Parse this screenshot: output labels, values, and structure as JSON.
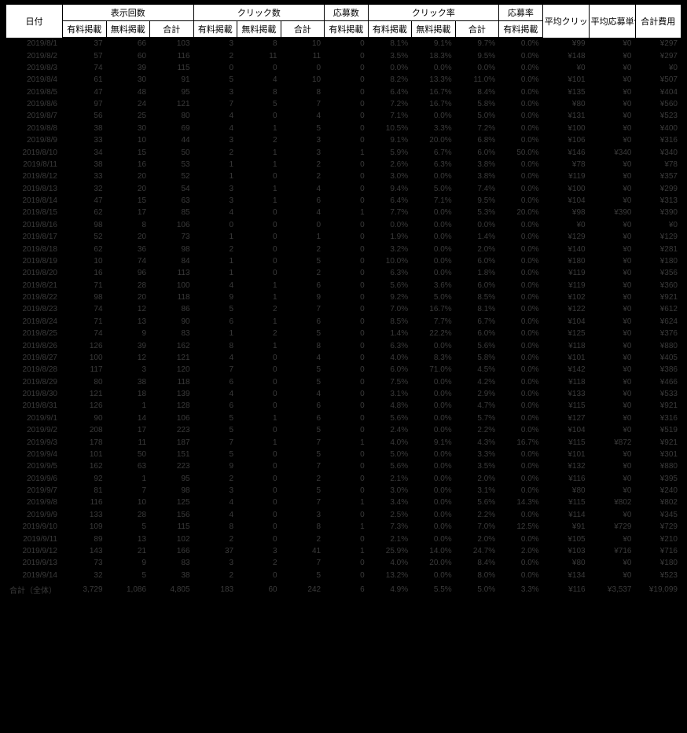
{
  "header": {
    "date": "日付",
    "impressions": "表示回数",
    "clicks": "クリック数",
    "applies": "応募数",
    "ctr": "クリック率",
    "apply_rate": "応募率",
    "avg_cpc": "平均クリック単価",
    "avg_apply_cost": "平均応募単価",
    "total_cost": "合計費用",
    "paid": "有料掲載",
    "free": "無料掲載",
    "total": "合計"
  },
  "summary_label": "合計（全体）",
  "summary": {
    "date": "合計（全体）",
    "imp_paid": "3,729",
    "imp_free": "1,086",
    "imp_total": "4,805",
    "clk_paid": "183",
    "clk_free": "60",
    "clk_total": "242",
    "app_paid": "6",
    "ctr_paid": "4.9%",
    "ctr_free": "5.5%",
    "ctr_total": "5.0%",
    "ar_paid": "3.3%",
    "avg_cpc": "¥116",
    "avg_apply": "¥3,537",
    "cost": "¥19,099"
  },
  "rows": [
    {
      "date": "2019/8/1",
      "imp_paid": "37",
      "imp_free": "66",
      "imp_total": "103",
      "clk_paid": "3",
      "clk_free": "8",
      "clk_total": "10",
      "app_paid": "0",
      "ctr_paid": "8.1%",
      "ctr_free": "9.1%",
      "ctr_total": "9.7%",
      "ar_paid": "0.0%",
      "avg_cpc": "¥99",
      "avg_apply": "¥0",
      "cost": "¥297"
    },
    {
      "date": "2019/8/2",
      "imp_paid": "57",
      "imp_free": "60",
      "imp_total": "116",
      "clk_paid": "2",
      "clk_free": "11",
      "clk_total": "11",
      "app_paid": "0",
      "ctr_paid": "3.5%",
      "ctr_free": "18.3%",
      "ctr_total": "9.5%",
      "ar_paid": "0.0%",
      "avg_cpc": "¥148",
      "avg_apply": "¥0",
      "cost": "¥297"
    },
    {
      "date": "2019/8/3",
      "imp_paid": "74",
      "imp_free": "39",
      "imp_total": "115",
      "clk_paid": "0",
      "clk_free": "0",
      "clk_total": "0",
      "app_paid": "0",
      "ctr_paid": "0.0%",
      "ctr_free": "0.0%",
      "ctr_total": "0.0%",
      "ar_paid": "0.0%",
      "avg_cpc": "¥0",
      "avg_apply": "¥0",
      "cost": "¥0"
    },
    {
      "date": "2019/8/4",
      "imp_paid": "61",
      "imp_free": "30",
      "imp_total": "91",
      "clk_paid": "5",
      "clk_free": "4",
      "clk_total": "10",
      "app_paid": "0",
      "ctr_paid": "8.2%",
      "ctr_free": "13.3%",
      "ctr_total": "11.0%",
      "ar_paid": "0.0%",
      "avg_cpc": "¥101",
      "avg_apply": "¥0",
      "cost": "¥507"
    },
    {
      "date": "2019/8/5",
      "imp_paid": "47",
      "imp_free": "48",
      "imp_total": "95",
      "clk_paid": "3",
      "clk_free": "8",
      "clk_total": "8",
      "app_paid": "0",
      "ctr_paid": "6.4%",
      "ctr_free": "16.7%",
      "ctr_total": "8.4%",
      "ar_paid": "0.0%",
      "avg_cpc": "¥135",
      "avg_apply": "¥0",
      "cost": "¥404"
    },
    {
      "date": "2019/8/6",
      "imp_paid": "97",
      "imp_free": "24",
      "imp_total": "121",
      "clk_paid": "7",
      "clk_free": "5",
      "clk_total": "7",
      "app_paid": "0",
      "ctr_paid": "7.2%",
      "ctr_free": "16.7%",
      "ctr_total": "5.8%",
      "ar_paid": "0.0%",
      "avg_cpc": "¥80",
      "avg_apply": "¥0",
      "cost": "¥560"
    },
    {
      "date": "2019/8/7",
      "imp_paid": "56",
      "imp_free": "25",
      "imp_total": "80",
      "clk_paid": "4",
      "clk_free": "0",
      "clk_total": "4",
      "app_paid": "0",
      "ctr_paid": "7.1%",
      "ctr_free": "0.0%",
      "ctr_total": "5.0%",
      "ar_paid": "0.0%",
      "avg_cpc": "¥131",
      "avg_apply": "¥0",
      "cost": "¥523"
    },
    {
      "date": "2019/8/8",
      "imp_paid": "38",
      "imp_free": "30",
      "imp_total": "69",
      "clk_paid": "4",
      "clk_free": "1",
      "clk_total": "5",
      "app_paid": "0",
      "ctr_paid": "10.5%",
      "ctr_free": "3.3%",
      "ctr_total": "7.2%",
      "ar_paid": "0.0%",
      "avg_cpc": "¥100",
      "avg_apply": "¥0",
      "cost": "¥400"
    },
    {
      "date": "2019/8/9",
      "imp_paid": "33",
      "imp_free": "10",
      "imp_total": "44",
      "clk_paid": "3",
      "clk_free": "2",
      "clk_total": "3",
      "app_paid": "0",
      "ctr_paid": "9.1%",
      "ctr_free": "20.0%",
      "ctr_total": "6.8%",
      "ar_paid": "0.0%",
      "avg_cpc": "¥106",
      "avg_apply": "¥0",
      "cost": "¥316"
    },
    {
      "date": "2019/8/10",
      "imp_paid": "34",
      "imp_free": "15",
      "imp_total": "50",
      "clk_paid": "2",
      "clk_free": "1",
      "clk_total": "3",
      "app_paid": "1",
      "ctr_paid": "5.9%",
      "ctr_free": "6.7%",
      "ctr_total": "6.0%",
      "ar_paid": "50.0%",
      "avg_cpc": "¥146",
      "avg_apply": "¥340",
      "cost": "¥340"
    },
    {
      "date": "2019/8/11",
      "imp_paid": "38",
      "imp_free": "16",
      "imp_total": "53",
      "clk_paid": "1",
      "clk_free": "1",
      "clk_total": "2",
      "app_paid": "0",
      "ctr_paid": "2.6%",
      "ctr_free": "6.3%",
      "ctr_total": "3.8%",
      "ar_paid": "0.0%",
      "avg_cpc": "¥78",
      "avg_apply": "¥0",
      "cost": "¥78"
    },
    {
      "date": "2019/8/12",
      "imp_paid": "33",
      "imp_free": "20",
      "imp_total": "52",
      "clk_paid": "1",
      "clk_free": "0",
      "clk_total": "2",
      "app_paid": "0",
      "ctr_paid": "3.0%",
      "ctr_free": "0.0%",
      "ctr_total": "3.8%",
      "ar_paid": "0.0%",
      "avg_cpc": "¥119",
      "avg_apply": "¥0",
      "cost": "¥357"
    },
    {
      "date": "2019/8/13",
      "imp_paid": "32",
      "imp_free": "20",
      "imp_total": "54",
      "clk_paid": "3",
      "clk_free": "1",
      "clk_total": "4",
      "app_paid": "0",
      "ctr_paid": "9.4%",
      "ctr_free": "5.0%",
      "ctr_total": "7.4%",
      "ar_paid": "0.0%",
      "avg_cpc": "¥100",
      "avg_apply": "¥0",
      "cost": "¥299"
    },
    {
      "date": "2019/8/14",
      "imp_paid": "47",
      "imp_free": "15",
      "imp_total": "63",
      "clk_paid": "3",
      "clk_free": "1",
      "clk_total": "6",
      "app_paid": "0",
      "ctr_paid": "6.4%",
      "ctr_free": "7.1%",
      "ctr_total": "9.5%",
      "ar_paid": "0.0%",
      "avg_cpc": "¥104",
      "avg_apply": "¥0",
      "cost": "¥313"
    },
    {
      "date": "2019/8/15",
      "imp_paid": "62",
      "imp_free": "17",
      "imp_total": "85",
      "clk_paid": "4",
      "clk_free": "0",
      "clk_total": "4",
      "app_paid": "1",
      "ctr_paid": "7.7%",
      "ctr_free": "0.0%",
      "ctr_total": "5.3%",
      "ar_paid": "20.0%",
      "avg_cpc": "¥98",
      "avg_apply": "¥390",
      "cost": "¥390"
    },
    {
      "date": "2019/8/16",
      "imp_paid": "98",
      "imp_free": "8",
      "imp_total": "106",
      "clk_paid": "0",
      "clk_free": "0",
      "clk_total": "0",
      "app_paid": "0",
      "ctr_paid": "0.0%",
      "ctr_free": "0.0%",
      "ctr_total": "0.0%",
      "ar_paid": "0.0%",
      "avg_cpc": "¥0",
      "avg_apply": "¥0",
      "cost": "¥0"
    },
    {
      "date": "2019/8/17",
      "imp_paid": "52",
      "imp_free": "20",
      "imp_total": "73",
      "clk_paid": "1",
      "clk_free": "0",
      "clk_total": "1",
      "app_paid": "0",
      "ctr_paid": "1.9%",
      "ctr_free": "0.0%",
      "ctr_total": "1.4%",
      "ar_paid": "0.0%",
      "avg_cpc": "¥129",
      "avg_apply": "¥0",
      "cost": "¥129"
    },
    {
      "date": "2019/8/18",
      "imp_paid": "62",
      "imp_free": "36",
      "imp_total": "98",
      "clk_paid": "2",
      "clk_free": "0",
      "clk_total": "2",
      "app_paid": "0",
      "ctr_paid": "3.2%",
      "ctr_free": "0.0%",
      "ctr_total": "2.0%",
      "ar_paid": "0.0%",
      "avg_cpc": "¥140",
      "avg_apply": "¥0",
      "cost": "¥281"
    },
    {
      "date": "2019/8/19",
      "imp_paid": "10",
      "imp_free": "74",
      "imp_total": "84",
      "clk_paid": "1",
      "clk_free": "0",
      "clk_total": "5",
      "app_paid": "0",
      "ctr_paid": "10.0%",
      "ctr_free": "0.0%",
      "ctr_total": "6.0%",
      "ar_paid": "0.0%",
      "avg_cpc": "¥180",
      "avg_apply": "¥0",
      "cost": "¥180"
    },
    {
      "date": "2019/8/20",
      "imp_paid": "16",
      "imp_free": "96",
      "imp_total": "113",
      "clk_paid": "1",
      "clk_free": "0",
      "clk_total": "2",
      "app_paid": "0",
      "ctr_paid": "6.3%",
      "ctr_free": "0.0%",
      "ctr_total": "1.8%",
      "ar_paid": "0.0%",
      "avg_cpc": "¥119",
      "avg_apply": "¥0",
      "cost": "¥356"
    },
    {
      "date": "2019/8/21",
      "imp_paid": "71",
      "imp_free": "28",
      "imp_total": "100",
      "clk_paid": "4",
      "clk_free": "1",
      "clk_total": "6",
      "app_paid": "0",
      "ctr_paid": "5.6%",
      "ctr_free": "3.6%",
      "ctr_total": "6.0%",
      "ar_paid": "0.0%",
      "avg_cpc": "¥119",
      "avg_apply": "¥0",
      "cost": "¥360"
    },
    {
      "date": "2019/8/22",
      "imp_paid": "98",
      "imp_free": "20",
      "imp_total": "118",
      "clk_paid": "9",
      "clk_free": "1",
      "clk_total": "9",
      "app_paid": "0",
      "ctr_paid": "9.2%",
      "ctr_free": "5.0%",
      "ctr_total": "8.5%",
      "ar_paid": "0.0%",
      "avg_cpc": "¥102",
      "avg_apply": "¥0",
      "cost": "¥921"
    },
    {
      "date": "2019/8/23",
      "imp_paid": "74",
      "imp_free": "12",
      "imp_total": "86",
      "clk_paid": "5",
      "clk_free": "2",
      "clk_total": "7",
      "app_paid": "0",
      "ctr_paid": "7.0%",
      "ctr_free": "16.7%",
      "ctr_total": "8.1%",
      "ar_paid": "0.0%",
      "avg_cpc": "¥122",
      "avg_apply": "¥0",
      "cost": "¥612"
    },
    {
      "date": "2019/8/24",
      "imp_paid": "71",
      "imp_free": "13",
      "imp_total": "90",
      "clk_paid": "6",
      "clk_free": "1",
      "clk_total": "6",
      "app_paid": "0",
      "ctr_paid": "8.5%",
      "ctr_free": "7.7%",
      "ctr_total": "6.7%",
      "ar_paid": "0.0%",
      "avg_cpc": "¥104",
      "avg_apply": "¥0",
      "cost": "¥624"
    },
    {
      "date": "2019/8/25",
      "imp_paid": "74",
      "imp_free": "9",
      "imp_total": "83",
      "clk_paid": "1",
      "clk_free": "2",
      "clk_total": "5",
      "app_paid": "0",
      "ctr_paid": "1.4%",
      "ctr_free": "22.2%",
      "ctr_total": "6.0%",
      "ar_paid": "0.0%",
      "avg_cpc": "¥125",
      "avg_apply": "¥0",
      "cost": "¥376"
    },
    {
      "date": "2019/8/26",
      "imp_paid": "126",
      "imp_free": "39",
      "imp_total": "162",
      "clk_paid": "8",
      "clk_free": "1",
      "clk_total": "8",
      "app_paid": "0",
      "ctr_paid": "6.3%",
      "ctr_free": "0.0%",
      "ctr_total": "5.6%",
      "ar_paid": "0.0%",
      "avg_cpc": "¥118",
      "avg_apply": "¥0",
      "cost": "¥880"
    },
    {
      "date": "2019/8/27",
      "imp_paid": "100",
      "imp_free": "12",
      "imp_total": "121",
      "clk_paid": "4",
      "clk_free": "0",
      "clk_total": "4",
      "app_paid": "0",
      "ctr_paid": "4.0%",
      "ctr_free": "8.3%",
      "ctr_total": "5.8%",
      "ar_paid": "0.0%",
      "avg_cpc": "¥101",
      "avg_apply": "¥0",
      "cost": "¥405"
    },
    {
      "date": "2019/8/28",
      "imp_paid": "117",
      "imp_free": "3",
      "imp_total": "120",
      "clk_paid": "7",
      "clk_free": "0",
      "clk_total": "5",
      "app_paid": "0",
      "ctr_paid": "6.0%",
      "ctr_free": "71.0%",
      "ctr_total": "4.5%",
      "ar_paid": "0.0%",
      "avg_cpc": "¥142",
      "avg_apply": "¥0",
      "cost": "¥386"
    },
    {
      "date": "2019/8/29",
      "imp_paid": "80",
      "imp_free": "38",
      "imp_total": "118",
      "clk_paid": "6",
      "clk_free": "0",
      "clk_total": "5",
      "app_paid": "0",
      "ctr_paid": "7.5%",
      "ctr_free": "0.0%",
      "ctr_total": "4.2%",
      "ar_paid": "0.0%",
      "avg_cpc": "¥118",
      "avg_apply": "¥0",
      "cost": "¥466"
    },
    {
      "date": "2019/8/30",
      "imp_paid": "121",
      "imp_free": "18",
      "imp_total": "139",
      "clk_paid": "4",
      "clk_free": "0",
      "clk_total": "4",
      "app_paid": "0",
      "ctr_paid": "3.1%",
      "ctr_free": "0.0%",
      "ctr_total": "2.9%",
      "ar_paid": "0.0%",
      "avg_cpc": "¥133",
      "avg_apply": "¥0",
      "cost": "¥533"
    },
    {
      "date": "2019/8/31",
      "imp_paid": "126",
      "imp_free": "1",
      "imp_total": "128",
      "clk_paid": "6",
      "clk_free": "0",
      "clk_total": "6",
      "app_paid": "0",
      "ctr_paid": "4.8%",
      "ctr_free": "0.0%",
      "ctr_total": "4.7%",
      "ar_paid": "0.0%",
      "avg_cpc": "¥115",
      "avg_apply": "¥0",
      "cost": "¥921"
    },
    {
      "date": "2019/9/1",
      "imp_paid": "90",
      "imp_free": "14",
      "imp_total": "106",
      "clk_paid": "5",
      "clk_free": "1",
      "clk_total": "6",
      "app_paid": "0",
      "ctr_paid": "5.6%",
      "ctr_free": "0.0%",
      "ctr_total": "5.7%",
      "ar_paid": "0.0%",
      "avg_cpc": "¥127",
      "avg_apply": "¥0",
      "cost": "¥316"
    },
    {
      "date": "2019/9/2",
      "imp_paid": "208",
      "imp_free": "17",
      "imp_total": "223",
      "clk_paid": "5",
      "clk_free": "0",
      "clk_total": "5",
      "app_paid": "0",
      "ctr_paid": "2.4%",
      "ctr_free": "0.0%",
      "ctr_total": "2.2%",
      "ar_paid": "0.0%",
      "avg_cpc": "¥104",
      "avg_apply": "¥0",
      "cost": "¥519"
    },
    {
      "date": "2019/9/3",
      "imp_paid": "178",
      "imp_free": "11",
      "imp_total": "187",
      "clk_paid": "7",
      "clk_free": "1",
      "clk_total": "7",
      "app_paid": "1",
      "ctr_paid": "4.0%",
      "ctr_free": "9.1%",
      "ctr_total": "4.3%",
      "ar_paid": "16.7%",
      "avg_cpc": "¥115",
      "avg_apply": "¥872",
      "cost": "¥921"
    },
    {
      "date": "2019/9/4",
      "imp_paid": "101",
      "imp_free": "50",
      "imp_total": "151",
      "clk_paid": "5",
      "clk_free": "0",
      "clk_total": "5",
      "app_paid": "0",
      "ctr_paid": "5.0%",
      "ctr_free": "0.0%",
      "ctr_total": "3.3%",
      "ar_paid": "0.0%",
      "avg_cpc": "¥101",
      "avg_apply": "¥0",
      "cost": "¥301"
    },
    {
      "date": "2019/9/5",
      "imp_paid": "162",
      "imp_free": "63",
      "imp_total": "223",
      "clk_paid": "9",
      "clk_free": "0",
      "clk_total": "7",
      "app_paid": "0",
      "ctr_paid": "5.6%",
      "ctr_free": "0.0%",
      "ctr_total": "3.5%",
      "ar_paid": "0.0%",
      "avg_cpc": "¥132",
      "avg_apply": "¥0",
      "cost": "¥880"
    },
    {
      "date": "2019/9/6",
      "imp_paid": "92",
      "imp_free": "1",
      "imp_total": "95",
      "clk_paid": "2",
      "clk_free": "0",
      "clk_total": "2",
      "app_paid": "0",
      "ctr_paid": "2.1%",
      "ctr_free": "0.0%",
      "ctr_total": "2.0%",
      "ar_paid": "0.0%",
      "avg_cpc": "¥116",
      "avg_apply": "¥0",
      "cost": "¥395"
    },
    {
      "date": "2019/9/7",
      "imp_paid": "81",
      "imp_free": "7",
      "imp_total": "98",
      "clk_paid": "3",
      "clk_free": "0",
      "clk_total": "5",
      "app_paid": "0",
      "ctr_paid": "3.0%",
      "ctr_free": "0.0%",
      "ctr_total": "3.1%",
      "ar_paid": "0.0%",
      "avg_cpc": "¥80",
      "avg_apply": "¥0",
      "cost": "¥240"
    },
    {
      "date": "2019/9/8",
      "imp_paid": "116",
      "imp_free": "10",
      "imp_total": "125",
      "clk_paid": "4",
      "clk_free": "0",
      "clk_total": "7",
      "app_paid": "1",
      "ctr_paid": "3.4%",
      "ctr_free": "0.0%",
      "ctr_total": "5.6%",
      "ar_paid": "14.3%",
      "avg_cpc": "¥115",
      "avg_apply": "¥802",
      "cost": "¥802"
    },
    {
      "date": "2019/9/9",
      "imp_paid": "133",
      "imp_free": "28",
      "imp_total": "156",
      "clk_paid": "4",
      "clk_free": "0",
      "clk_total": "3",
      "app_paid": "0",
      "ctr_paid": "2.5%",
      "ctr_free": "0.0%",
      "ctr_total": "2.2%",
      "ar_paid": "0.0%",
      "avg_cpc": "¥114",
      "avg_apply": "¥0",
      "cost": "¥345"
    },
    {
      "date": "2019/9/10",
      "imp_paid": "109",
      "imp_free": "5",
      "imp_total": "115",
      "clk_paid": "8",
      "clk_free": "0",
      "clk_total": "8",
      "app_paid": "1",
      "ctr_paid": "7.3%",
      "ctr_free": "0.0%",
      "ctr_total": "7.0%",
      "ar_paid": "12.5%",
      "avg_cpc": "¥91",
      "avg_apply": "¥729",
      "cost": "¥729"
    },
    {
      "date": "2019/9/11",
      "imp_paid": "89",
      "imp_free": "13",
      "imp_total": "102",
      "clk_paid": "2",
      "clk_free": "0",
      "clk_total": "2",
      "app_paid": "0",
      "ctr_paid": "2.1%",
      "ctr_free": "0.0%",
      "ctr_total": "2.0%",
      "ar_paid": "0.0%",
      "avg_cpc": "¥105",
      "avg_apply": "¥0",
      "cost": "¥210"
    },
    {
      "date": "2019/9/12",
      "imp_paid": "143",
      "imp_free": "21",
      "imp_total": "166",
      "clk_paid": "37",
      "clk_free": "3",
      "clk_total": "41",
      "app_paid": "1",
      "ctr_paid": "25.9%",
      "ctr_free": "14.0%",
      "ctr_total": "24.7%",
      "ar_paid": "2.0%",
      "avg_cpc": "¥103",
      "avg_apply": "¥716",
      "cost": "¥716"
    },
    {
      "date": "2019/9/13",
      "imp_paid": "73",
      "imp_free": "9",
      "imp_total": "83",
      "clk_paid": "3",
      "clk_free": "2",
      "clk_total": "7",
      "app_paid": "0",
      "ctr_paid": "4.0%",
      "ctr_free": "20.0%",
      "ctr_total": "8.4%",
      "ar_paid": "0.0%",
      "avg_cpc": "¥80",
      "avg_apply": "¥0",
      "cost": "¥180"
    },
    {
      "date": "2019/9/14",
      "imp_paid": "32",
      "imp_free": "5",
      "imp_total": "38",
      "clk_paid": "2",
      "clk_free": "0",
      "clk_total": "5",
      "app_paid": "0",
      "ctr_paid": "13.2%",
      "ctr_free": "0.0%",
      "ctr_total": "8.0%",
      "ar_paid": "0.0%",
      "avg_cpc": "¥134",
      "avg_apply": "¥0",
      "cost": "¥523"
    }
  ]
}
